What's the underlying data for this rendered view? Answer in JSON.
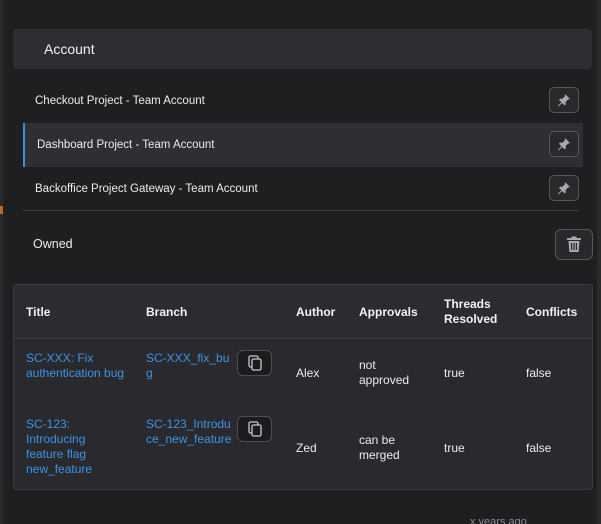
{
  "header": {
    "title": "Account"
  },
  "accounts": [
    {
      "label": "Checkout Project - Team Account",
      "icon": "pin-icon"
    },
    {
      "label": "Dashboard Project - Team Account",
      "icon": "pin-icon"
    },
    {
      "label": "Backoffice Project Gateway - Team Account",
      "icon": "pin-icon"
    }
  ],
  "owned": {
    "label": "Owned",
    "icon": "trash-icon"
  },
  "table": {
    "columns": [
      "Title",
      "Branch",
      "Author",
      "Approvals",
      "Threads Resolved",
      "Conflicts"
    ],
    "rows": [
      {
        "title": "SC-XXX: Fix authentication bug",
        "branch": "SC-XXX_fix_bug",
        "author": "Alex",
        "approvals": "not approved",
        "threads_resolved": "true",
        "conflicts": "false"
      },
      {
        "title": "SC-123: Introducing feature flag new_feature",
        "branch": "SC-123_Introduce_new_feature",
        "author": "Zed",
        "approvals": "can be merged",
        "threads_resolved": "true",
        "conflicts": "false"
      }
    ]
  },
  "footer": {
    "partial_text": "x years ago"
  },
  "colors": {
    "accent": "#3b8fd8",
    "link": "#3d93e6",
    "background": "#1f1f22"
  }
}
